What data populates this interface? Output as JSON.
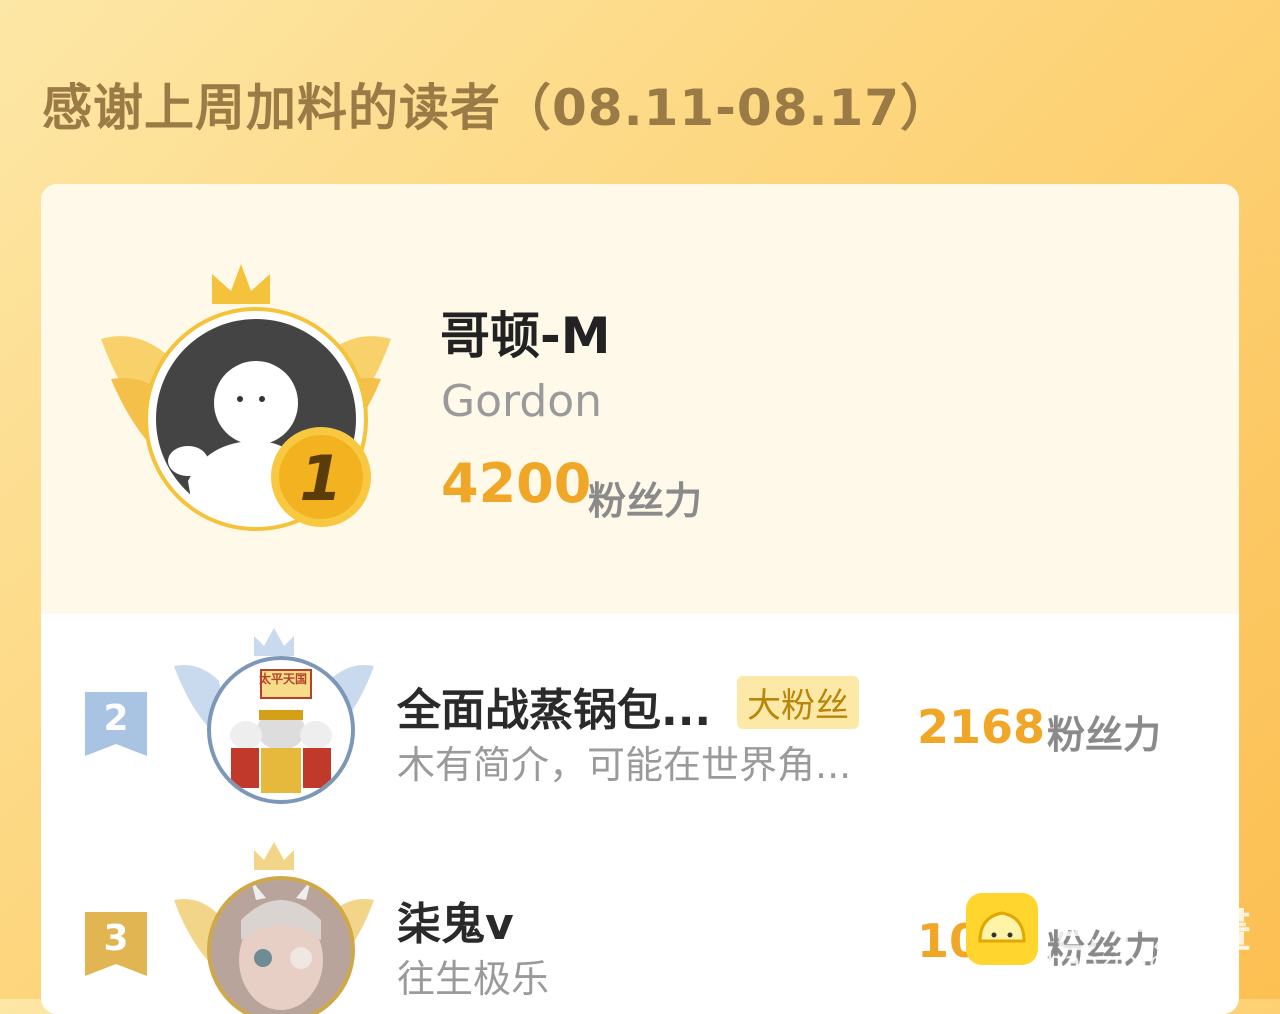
{
  "header": {
    "title": "感谢上周加料的读者（08.11-08.17）"
  },
  "top": {
    "rank": "1",
    "name": "哥顿-M",
    "subtitle": "Gordon",
    "score": "4200",
    "unit": "粉丝力"
  },
  "list": [
    {
      "rank": "2",
      "name": "全面战蒸锅包...",
      "tag": "大粉丝",
      "desc": "木有简介，可能在世界角...",
      "score": "2168",
      "unit": "粉丝力",
      "avatar_banner": "太平天国"
    },
    {
      "rank": "3",
      "name": "柒鬼v",
      "desc": "往生极乐",
      "score": "10",
      "unit": "粉丝力"
    }
  ],
  "watermark": {
    "text": "包子漫畫",
    "url": "baozimh.com"
  },
  "colors": {
    "accent": "#f0a626",
    "title": "#9a7a45",
    "silver": "#a9c4e3",
    "gold": "#e0b552"
  }
}
